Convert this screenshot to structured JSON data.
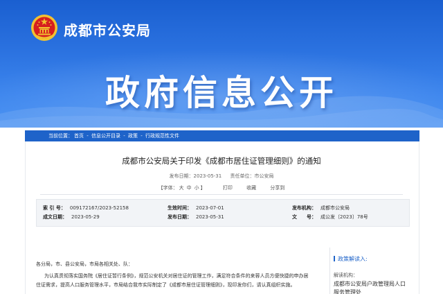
{
  "header": {
    "site_name": "成都市公安局",
    "banner_title": "政府信息公开"
  },
  "breadcrumb": {
    "prefix": "当前位置：",
    "items": [
      "首页",
      "信息公开目录",
      "政策",
      "行政规范性文件"
    ],
    "separator": " - "
  },
  "document": {
    "title": "成都市公安局关于印发《成都市居住证管理细则》的通知",
    "publish_date_label": "发布日期：",
    "publish_date": "2023-05-31",
    "responsible_unit_label": "责任单位：",
    "responsible_unit": "市公安局",
    "font_size_label": "【字体：",
    "font_large": "大",
    "font_medium": "中",
    "font_small": "小",
    "font_size_end": "】",
    "print_label": "打印",
    "favorite_label": "收藏",
    "share_label": "分享到"
  },
  "info": {
    "index_label": "索 引 号：",
    "index_value": "009172167/2023-52158",
    "effective_label": "生效时间：",
    "effective_value": "2023-07-01",
    "issuer_label": "发布机构：",
    "issuer_value": "成都市公安局",
    "written_label": "成文日期：",
    "written_value": "2023-05-29",
    "release_label": "发布日期：",
    "release_value": "2023-05-31",
    "docno_label": "文　　号：",
    "docno_value": "成公发〔2023〕78号"
  },
  "body": {
    "greeting": "各分局，市、县公安局，市局各相关处、队：",
    "para1_line1": "为认真贯彻落实国务院《居住证暂行条例》，规范公安机关对居住证的管理工作，满足符合条件的来蓉人员方便快捷的申办居",
    "para1_line2": "住证需求，提高人口服务管理水平，市局结合我市实际制定了《成都市居住证管理细则》，现印发你们，请认真组织实施。"
  },
  "sidebar": {
    "heading": "政策解读入:",
    "label": "解读机构：",
    "org": "成都市公安局户政管理局人口服务管理处"
  },
  "colors": {
    "banner_top": "#1a5fd0",
    "banner_bottom": "#4c93f2",
    "accent": "#1e63c9",
    "emblem_red": "#d61f1f",
    "emblem_gold": "#f2c230"
  }
}
